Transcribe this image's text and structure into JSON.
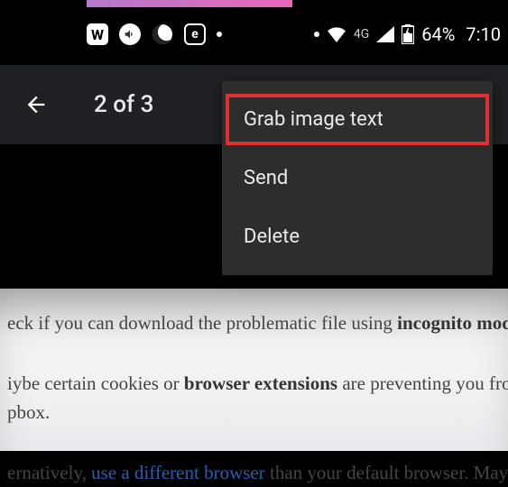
{
  "statusbar": {
    "w_icon_label": "W",
    "e_icon_label": "e",
    "network_type": "4G",
    "battery": "64%",
    "time": "7:10"
  },
  "header": {
    "position": "2 of 3"
  },
  "menu": {
    "items": [
      {
        "label": "Grab image text"
      },
      {
        "label": "Send"
      },
      {
        "label": "Delete"
      }
    ]
  },
  "image_content": {
    "p1_a": "eck if you can download the problematic file using ",
    "p1_b": "incognito mode",
    "p2_a": "iybe certain cookies or ",
    "p2_b": "browser extensions",
    "p2_c": " are preventing you from",
    "p3": "pbox.",
    "p4_a": "ernatively, ",
    "p4_b": "use a different browser",
    "p4_c": " than your default browser. Mayb"
  }
}
